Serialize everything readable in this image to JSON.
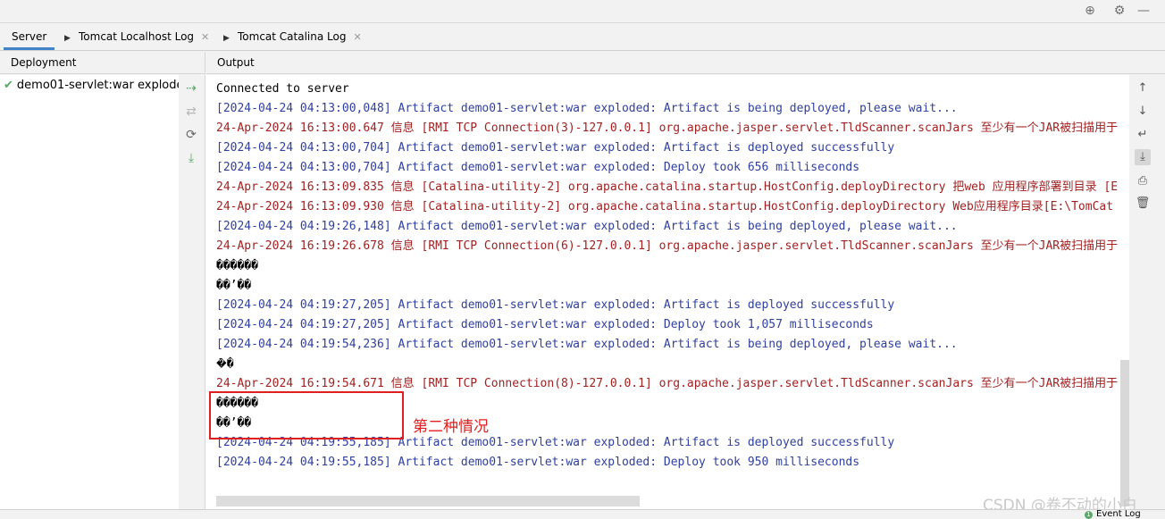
{
  "toolbar": {
    "target_icon": "target-icon",
    "settings_icon": "gear-icon",
    "minimize_icon": "minimize-icon"
  },
  "tabs": [
    {
      "label": "Server",
      "active": true
    },
    {
      "label": "Tomcat Localhost Log",
      "active": false
    },
    {
      "label": "Tomcat Catalina Log",
      "active": false
    }
  ],
  "deployment": {
    "header": "Deployment",
    "items": [
      {
        "label": "demo01-servlet:war exploded",
        "status": "deployed"
      }
    ]
  },
  "output": {
    "header": "Output",
    "lines": [
      {
        "text": "Connected to server",
        "color": "black"
      },
      {
        "text": "[2024-04-24 04:13:00,048] Artifact demo01-servlet:war exploded: Artifact is being deployed, please wait...",
        "color": "blue"
      },
      {
        "text": "24-Apr-2024 16:13:00.647 信息 [RMI TCP Connection(3)-127.0.0.1] org.apache.jasper.servlet.TldScanner.scanJars 至少有一个JAR被扫描用于",
        "color": "red"
      },
      {
        "text": "[2024-04-24 04:13:00,704] Artifact demo01-servlet:war exploded: Artifact is deployed successfully",
        "color": "blue"
      },
      {
        "text": "[2024-04-24 04:13:00,704] Artifact demo01-servlet:war exploded: Deploy took 656 milliseconds",
        "color": "blue"
      },
      {
        "text": "24-Apr-2024 16:13:09.835 信息 [Catalina-utility-2] org.apache.catalina.startup.HostConfig.deployDirectory 把web 应用程序部署到目录 [E",
        "color": "red"
      },
      {
        "text": "24-Apr-2024 16:13:09.930 信息 [Catalina-utility-2] org.apache.catalina.startup.HostConfig.deployDirectory Web应用程序目录[E:\\TomCat",
        "color": "red"
      },
      {
        "text": "[2024-04-24 04:19:26,148] Artifact demo01-servlet:war exploded: Artifact is being deployed, please wait...",
        "color": "blue"
      },
      {
        "text": "24-Apr-2024 16:19:26.678 信息 [RMI TCP Connection(6)-127.0.0.1] org.apache.jasper.servlet.TldScanner.scanJars 至少有一个JAR被扫描用于",
        "color": "red"
      },
      {
        "text": "������",
        "color": "black"
      },
      {
        "text": "��’��",
        "color": "black"
      },
      {
        "text": "[2024-04-24 04:19:27,205] Artifact demo01-servlet:war exploded: Artifact is deployed successfully",
        "color": "blue"
      },
      {
        "text": "[2024-04-24 04:19:27,205] Artifact demo01-servlet:war exploded: Deploy took 1,057 milliseconds",
        "color": "blue"
      },
      {
        "text": "[2024-04-24 04:19:54,236] Artifact demo01-servlet:war exploded: Artifact is being deployed, please wait...",
        "color": "blue"
      },
      {
        "text": "�ܳ�",
        "color": "black"
      },
      {
        "text": "24-Apr-2024 16:19:54.671 信息 [RMI TCP Connection(8)-127.0.0.1] org.apache.jasper.servlet.TldScanner.scanJars 至少有一个JAR被扫描用于",
        "color": "red"
      },
      {
        "text": "������",
        "color": "black"
      },
      {
        "text": "��’��",
        "color": "black"
      },
      {
        "text": "[2024-04-24 04:19:55,185] Artifact demo01-servlet:war exploded: Artifact is deployed successfully",
        "color": "blue"
      },
      {
        "text": "[2024-04-24 04:19:55,185] Artifact demo01-servlet:war exploded: Deploy took 950 milliseconds",
        "color": "blue"
      }
    ]
  },
  "annotation": {
    "text": "第二种情况",
    "color": "#e02020"
  },
  "status_bar": {
    "event_log": "Event Log",
    "event_count": "1"
  },
  "watermark": "CSDN @卷不动的小白",
  "colors": {
    "blue": "#2f3f9e",
    "red": "#a12121",
    "black": "#000000",
    "accent": "#4083c9",
    "ok": "#59a869"
  }
}
